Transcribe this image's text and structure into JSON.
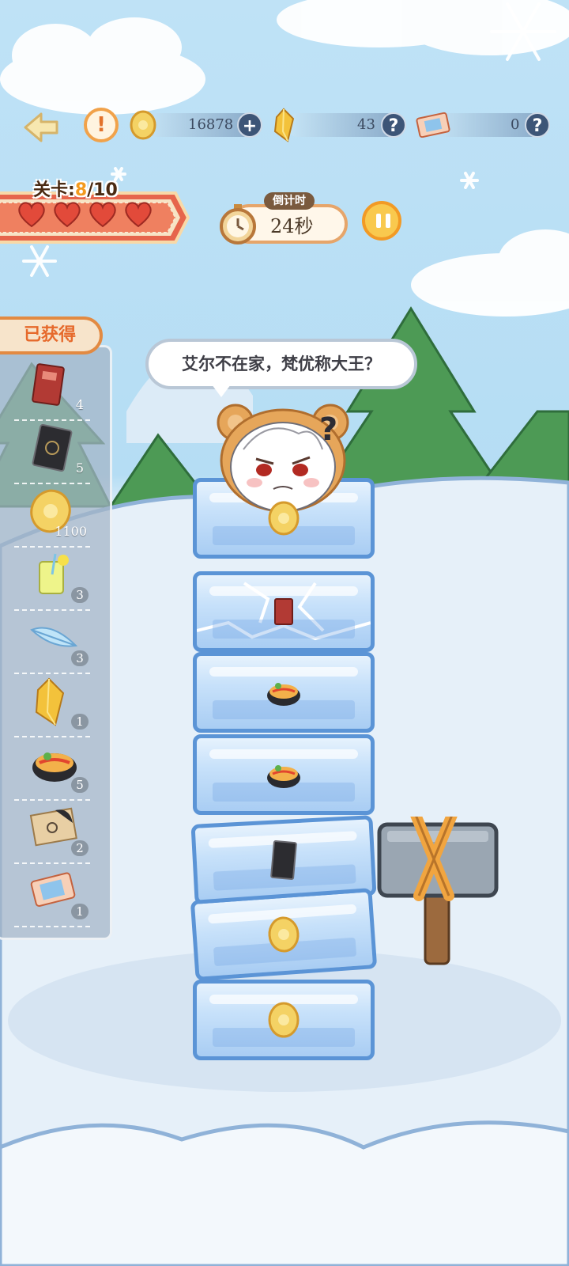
{
  "topbar": {
    "coins": "16878",
    "crystals": "43",
    "tickets": "0",
    "add_symbol": "+",
    "help_symbol": "?",
    "info_symbol": "!"
  },
  "level": {
    "label_prefix": "关卡:",
    "current": "8",
    "total_text": "/10",
    "hearts": 4
  },
  "timer": {
    "tag": "倒计时",
    "value": "24秒"
  },
  "obtained": {
    "title": "已获得",
    "items": [
      {
        "icon": "red-card-icon",
        "count": "4"
      },
      {
        "icon": "black-card-icon",
        "count": "5"
      },
      {
        "icon": "gold-coin-icon",
        "count": "1100"
      },
      {
        "icon": "lemonade-icon",
        "count": "3"
      },
      {
        "icon": "feather-icon",
        "count": "3"
      },
      {
        "icon": "crystal-icon",
        "count": "1"
      },
      {
        "icon": "food-bowl-icon",
        "count": "5"
      },
      {
        "icon": "map-scroll-icon",
        "count": "2"
      },
      {
        "icon": "ticket-icon",
        "count": "1"
      }
    ]
  },
  "dialog": {
    "speech": "艾尔不在家，梵优称大王？",
    "question_mark": "?"
  },
  "tower": {
    "blocks": [
      "gold-coin-icon",
      "red-card-icon",
      "food-bowl-icon",
      "food-bowl-icon",
      "black-card-icon",
      "gold-coin-icon",
      "gold-coin-icon"
    ]
  },
  "colors": {
    "accent_orange": "#f29a25",
    "heart_red": "#e24a3a",
    "ice_border": "#5b94d6"
  }
}
